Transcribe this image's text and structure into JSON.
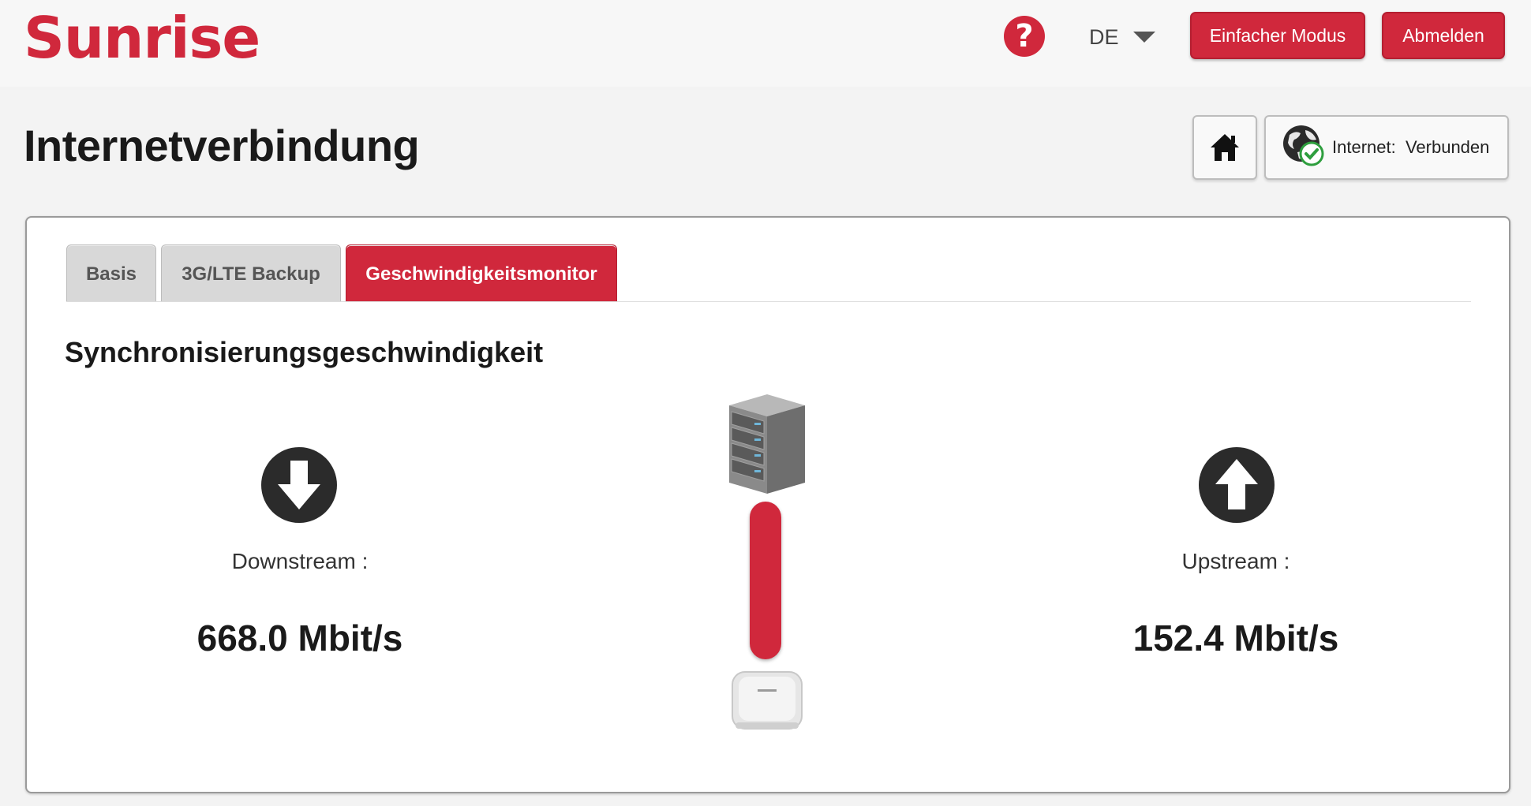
{
  "header": {
    "logo": "Sunrise",
    "help_symbol": "?",
    "language": "DE",
    "simple_mode_label": "Einfacher Modus",
    "logout_label": "Abmelden"
  },
  "page": {
    "title": "Internetverbindung",
    "status_label": "Internet:",
    "status_value": "Verbunden"
  },
  "tabs": [
    {
      "label": "Basis",
      "active": false
    },
    {
      "label": "3G/LTE Backup",
      "active": false
    },
    {
      "label": "Geschwindigkeitsmonitor",
      "active": true
    }
  ],
  "sync": {
    "title": "Synchronisierungsgeschwindigkeit",
    "downstream_label": "Downstream :",
    "downstream_value": "668.0 Mbit/s",
    "upstream_label": "Upstream :",
    "upstream_value": "152.4 Mbit/s"
  },
  "icons": {
    "help": "question-circle-icon",
    "home": "home-icon",
    "internet": "globe-check-icon",
    "downstream": "arrow-down-circle-icon",
    "upstream": "arrow-up-circle-icon",
    "server": "server-icon",
    "router": "router-icon"
  },
  "colors": {
    "accent": "#d0283c",
    "dark_icon": "#2b2b2b",
    "status_ok": "#2e9e3e"
  }
}
